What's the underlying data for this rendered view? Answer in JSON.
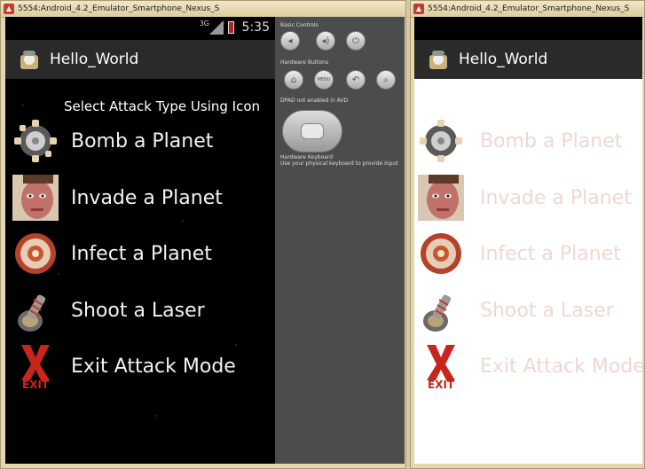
{
  "left_window": {
    "title": "5554:Android_4.2_Emulator_Smartphone_Nexus_S",
    "status": {
      "network": "3G",
      "time": "5:35"
    },
    "app_title": "Hello_World",
    "heading": "Select Attack Type Using Icon",
    "items": [
      {
        "label": "Bomb a Planet",
        "icon": "bomb-icon"
      },
      {
        "label": "Invade a Planet",
        "icon": "invader-face-icon"
      },
      {
        "label": "Infect a Planet",
        "icon": "virus-icon"
      },
      {
        "label": "Shoot a Laser",
        "icon": "laser-icon"
      },
      {
        "label": "Exit Attack Mode",
        "icon": "exit-icon"
      }
    ],
    "controls": {
      "basic_label": "Basic Controls",
      "hardware_label": "Hardware Buttons",
      "menu_label": "MENU",
      "dpad_label": "DPAD not enabled in AVD",
      "keyboard_label": "Hardware Keyboard",
      "keyboard_hint": "Use your physical keyboard to provide input"
    }
  },
  "right_window": {
    "title": "5554:Android_4.2_Emulator_Smartphone_Nexus_S",
    "app_title": "Hello_World",
    "items": [
      {
        "label": "Bomb a Planet",
        "icon": "bomb-icon"
      },
      {
        "label": "Invade a Planet",
        "icon": "invader-face-icon"
      },
      {
        "label": "Infect a Planet",
        "icon": "virus-icon"
      },
      {
        "label": "Shoot a Laser",
        "icon": "laser-icon"
      },
      {
        "label": "Exit Attack Mode",
        "icon": "exit-icon"
      }
    ]
  },
  "colors": {
    "window_frame": "#e3d6b0",
    "screen_background": "#000000",
    "action_bar": "#2a2a2a",
    "faded_label": "#eed8d2",
    "exit_red": "#c8251d"
  }
}
